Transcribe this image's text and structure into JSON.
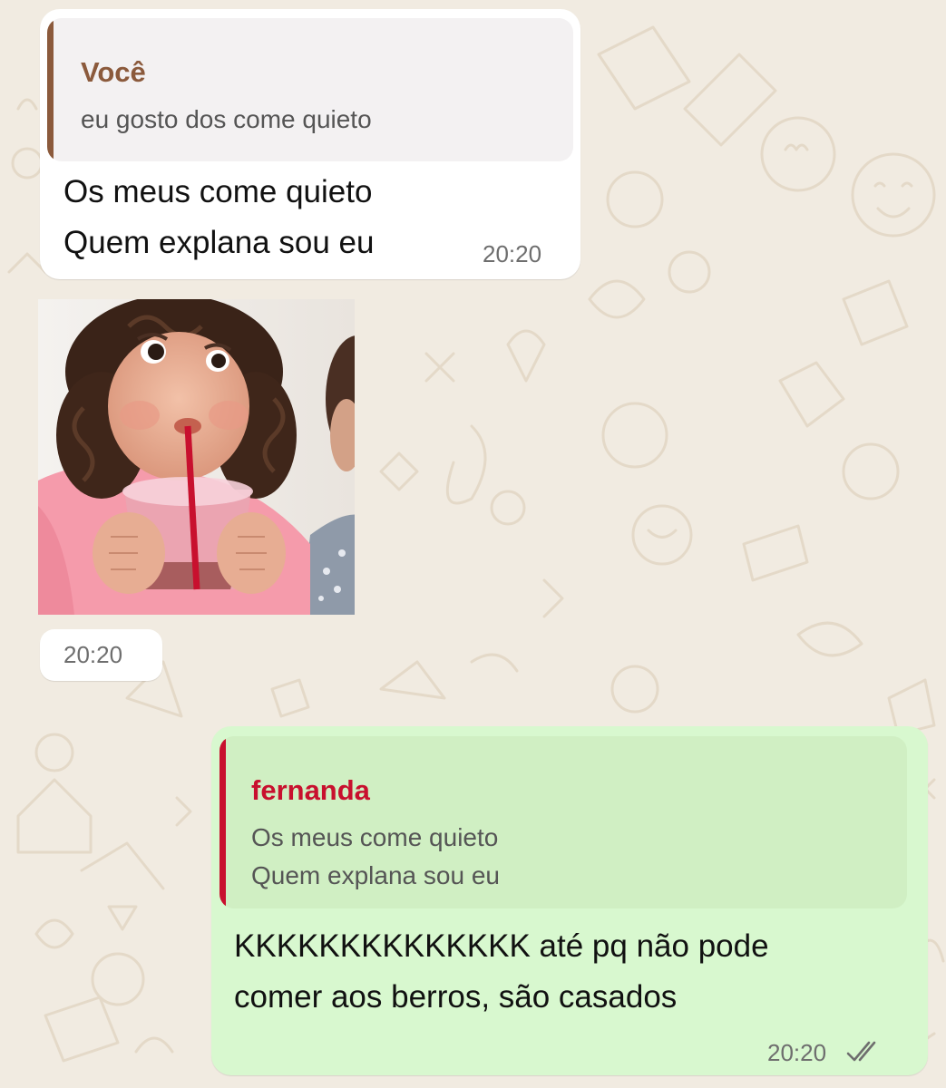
{
  "chat": {
    "messages": [
      {
        "direction": "incoming",
        "quote": {
          "author": "Você",
          "text": "eu gosto dos come quieto"
        },
        "lines": [
          "Os meus come quieto",
          "Quem explana sou eu"
        ],
        "time": "20:20"
      },
      {
        "direction": "incoming",
        "sticker": {
          "description": "child-sipping-drink-sticker"
        },
        "time": "20:20"
      },
      {
        "direction": "outgoing",
        "quote": {
          "author": "fernanda",
          "lines": [
            "Os meus come quieto",
            "Quem explana sou eu"
          ]
        },
        "lines": [
          "KKKKKKKKKKKKKK até pq não pode",
          "comer aos berros, são casados"
        ],
        "time": "20:20",
        "status_icon": "double-check-icon"
      }
    ]
  },
  "colors": {
    "wallpaper": "#f1ebe1",
    "incoming_bubble": "#ffffff",
    "outgoing_bubble": "#d8f8cf",
    "quote_author_voce": "#8b5a3c",
    "quote_author_fernanda": "#c8102e"
  }
}
